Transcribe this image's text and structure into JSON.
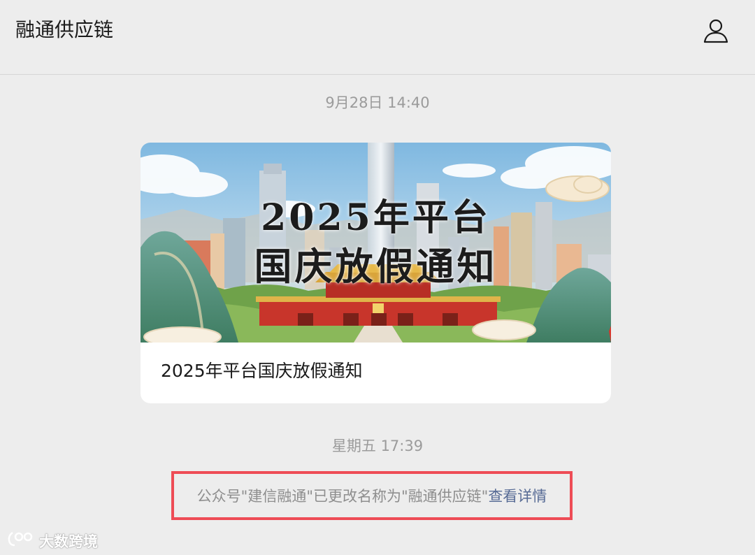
{
  "header": {
    "title": "融通供应链",
    "profile_icon": "person-icon"
  },
  "messages": [
    {
      "timestamp": "9月28日 14:40",
      "article": {
        "cover_line1": "2025年平台",
        "cover_line2": "国庆放假通知",
        "title": "2025年平台国庆放假通知"
      }
    },
    {
      "timestamp": "星期五 17:39",
      "system_notice": {
        "text": "公众号\"建信融通\"已更改名称为\"融通供应链\"",
        "link": "查看详情"
      }
    }
  ],
  "watermark": {
    "text": "大数跨境",
    "icon": "logo-icon"
  },
  "colors": {
    "background": "#ededed",
    "highlight_border": "#ee4c56",
    "link": "#576b95"
  }
}
